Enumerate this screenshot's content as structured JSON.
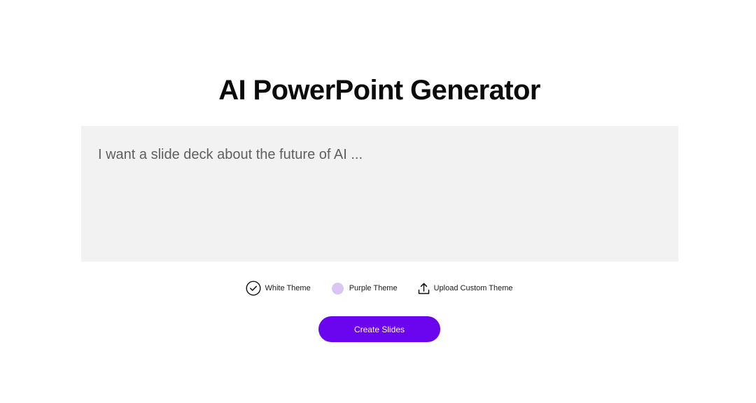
{
  "header": {
    "title": "AI PowerPoint Generator"
  },
  "prompt": {
    "placeholder": "I want a slide deck about the future of AI ...",
    "value": ""
  },
  "themes": {
    "options": [
      {
        "label": "White Theme",
        "icon": "check-circle-icon",
        "selected": true
      },
      {
        "label": "Purple Theme",
        "icon": "purple-swatch-icon",
        "color": "#d9c6f3",
        "selected": false
      },
      {
        "label": "Upload Custom Theme",
        "icon": "upload-icon",
        "selected": false
      }
    ]
  },
  "actions": {
    "create_label": "Create Slides",
    "accent_color": "#6b05f0"
  }
}
